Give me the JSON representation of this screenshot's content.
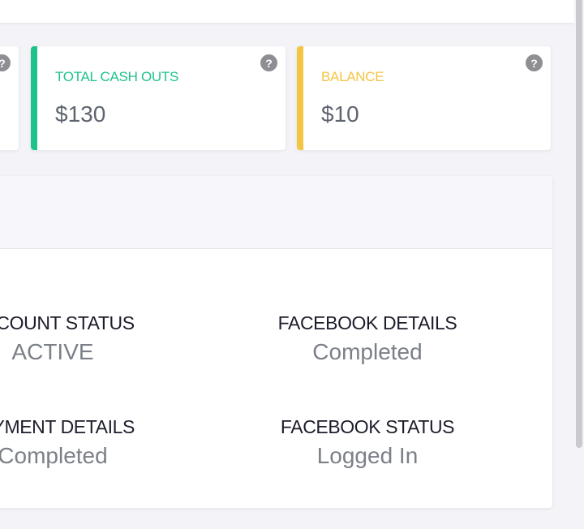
{
  "cards": {
    "cash_outs": {
      "label": "TOTAL CASH OUTS",
      "value": "$130",
      "color": "#1fc38a"
    },
    "balance": {
      "label": "BALANCE",
      "value": "$10",
      "color": "#f4c542"
    },
    "help_glyph": "?"
  },
  "status": {
    "account_status": {
      "title": "ACCOUNT STATUS",
      "value": "ACTIVE"
    },
    "facebook_details": {
      "title": "FACEBOOK DETAILS",
      "value": "Completed"
    },
    "payment_details": {
      "title": "PAYMENT DETAILS",
      "value": "Completed"
    },
    "facebook_status": {
      "title": "FACEBOOK STATUS",
      "value": "Logged In"
    }
  }
}
